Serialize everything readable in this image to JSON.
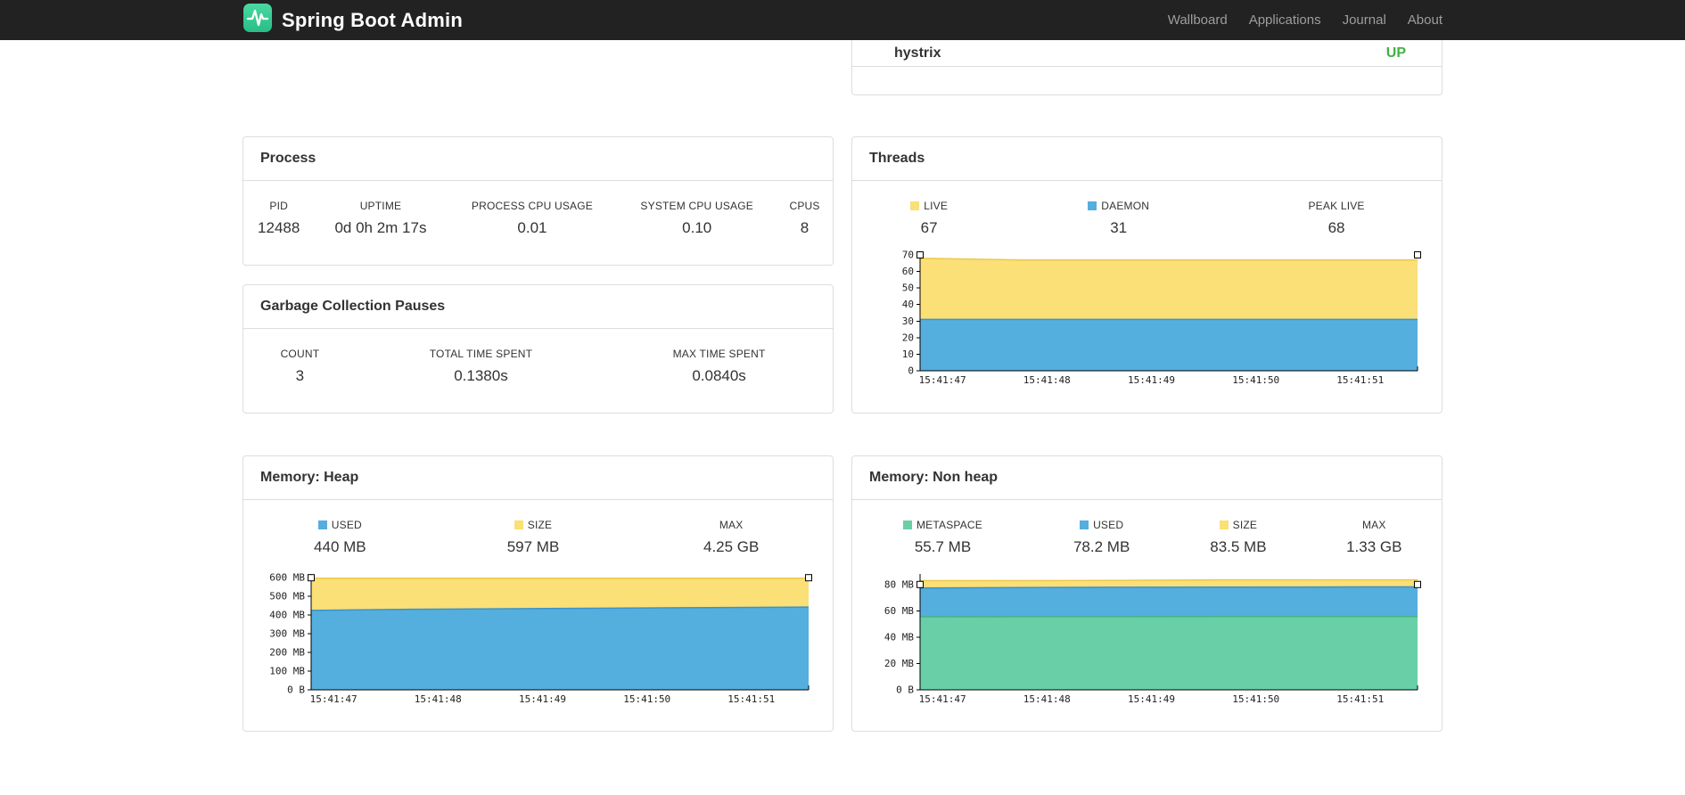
{
  "navbar": {
    "brand": "Spring Boot Admin",
    "links": [
      "Wallboard",
      "Applications",
      "Journal",
      "About"
    ]
  },
  "application": {
    "name": "hystrix",
    "status": "UP",
    "status_color": "#43b143"
  },
  "panels": {
    "process": {
      "title": "Process",
      "metrics": [
        {
          "label": "PID",
          "value": "12488"
        },
        {
          "label": "UPTIME",
          "value": "0d 0h 2m 17s"
        },
        {
          "label": "PROCESS CPU USAGE",
          "value": "0.01"
        },
        {
          "label": "SYSTEM CPU USAGE",
          "value": "0.10"
        },
        {
          "label": "CPUS",
          "value": "8"
        }
      ]
    },
    "gc": {
      "title": "Garbage Collection Pauses",
      "metrics": [
        {
          "label": "COUNT",
          "value": "3"
        },
        {
          "label": "TOTAL TIME SPENT",
          "value": "0.1380s"
        },
        {
          "label": "MAX TIME SPENT",
          "value": "0.0840s"
        }
      ]
    },
    "threads": {
      "title": "Threads",
      "metrics": [
        {
          "label": "LIVE",
          "value": "67",
          "swatch": "#fbdf77"
        },
        {
          "label": "DAEMON",
          "value": "31",
          "swatch": "#54aede"
        },
        {
          "label": "PEAK LIVE",
          "value": "68"
        }
      ]
    },
    "heap": {
      "title": "Memory: Heap",
      "metrics": [
        {
          "label": "USED",
          "value": "440 MB",
          "swatch": "#54aede"
        },
        {
          "label": "SIZE",
          "value": "597 MB",
          "swatch": "#fbdf77"
        },
        {
          "label": "MAX",
          "value": "4.25 GB"
        }
      ]
    },
    "nonheap": {
      "title": "Memory: Non heap",
      "metrics": [
        {
          "label": "METASPACE",
          "value": "55.7 MB",
          "swatch": "#69cfa7"
        },
        {
          "label": "USED",
          "value": "78.2 MB",
          "swatch": "#54aede"
        },
        {
          "label": "SIZE",
          "value": "83.5 MB",
          "swatch": "#fbdf77"
        },
        {
          "label": "MAX",
          "value": "1.33 GB"
        }
      ]
    }
  },
  "chart_data": [
    {
      "id": "threads",
      "type": "area",
      "title": "Threads",
      "x": [
        "15:41:47",
        "15:41:48",
        "15:41:49",
        "15:41:50",
        "15:41:51"
      ],
      "legend": [
        "LIVE",
        "DAEMON",
        "PEAK LIVE"
      ],
      "legend_position": "top",
      "grid": false,
      "ylim": [
        0,
        70
      ],
      "yticks": {
        "values": [
          0,
          10,
          20,
          30,
          40,
          50,
          60,
          70
        ],
        "labels": [
          "0",
          "10",
          "20",
          "30",
          "40",
          "50",
          "60",
          "70"
        ]
      },
      "series": [
        {
          "name": "LIVE",
          "fill": "#fbdf77",
          "stroke": "#edc84c",
          "values": [
            68,
            67,
            67,
            67,
            67,
            67
          ]
        },
        {
          "name": "DAEMON",
          "fill": "#54aede",
          "stroke": "#3d93c6",
          "values": [
            31,
            31,
            31,
            31,
            31,
            31
          ]
        }
      ]
    },
    {
      "id": "memory-heap",
      "type": "area",
      "title": "Memory: Heap",
      "x": [
        "15:41:47",
        "15:41:48",
        "15:41:49",
        "15:41:50",
        "15:41:51"
      ],
      "legend": [
        "USED",
        "SIZE",
        "MAX"
      ],
      "legend_position": "top",
      "grid": false,
      "ylim": [
        0,
        620
      ],
      "yticks": {
        "values": [
          0,
          100,
          200,
          300,
          400,
          500,
          600
        ],
        "labels": [
          "0 B",
          "100 MB",
          "200 MB",
          "300 MB",
          "400 MB",
          "500 MB",
          "600 MB"
        ]
      },
      "series": [
        {
          "name": "SIZE",
          "fill": "#fbdf77",
          "stroke": "#edc84c",
          "values": [
            597,
            597,
            597,
            597,
            597,
            597
          ]
        },
        {
          "name": "USED",
          "fill": "#54aede",
          "stroke": "#3d93c6",
          "values": [
            425,
            431,
            434,
            437,
            440,
            443
          ]
        }
      ]
    },
    {
      "id": "memory-nonheap",
      "type": "area",
      "title": "Memory: Non heap",
      "x": [
        "15:41:47",
        "15:41:48",
        "15:41:49",
        "15:41:50",
        "15:41:51"
      ],
      "legend": [
        "METASPACE",
        "USED",
        "SIZE",
        "MAX"
      ],
      "legend_position": "top",
      "grid": false,
      "ylim": [
        0,
        88
      ],
      "yticks": {
        "values": [
          0,
          20,
          40,
          60,
          80
        ],
        "labels": [
          "0 B",
          "20 MB",
          "40 MB",
          "60 MB",
          "80 MB"
        ]
      },
      "series": [
        {
          "name": "SIZE",
          "fill": "#fbdf77",
          "stroke": "#edc84c",
          "values": [
            82.9,
            82.9,
            83.1,
            83.5,
            83.5,
            83.5
          ]
        },
        {
          "name": "USED",
          "fill": "#54aede",
          "stroke": "#3d93c6",
          "values": [
            77.4,
            77.7,
            77.9,
            78.0,
            78.1,
            78.2
          ]
        },
        {
          "name": "METASPACE",
          "fill": "#69cfa7",
          "stroke": "#46b388",
          "values": [
            55.5,
            55.6,
            55.6,
            55.7,
            55.7,
            55.7
          ]
        }
      ]
    }
  ]
}
